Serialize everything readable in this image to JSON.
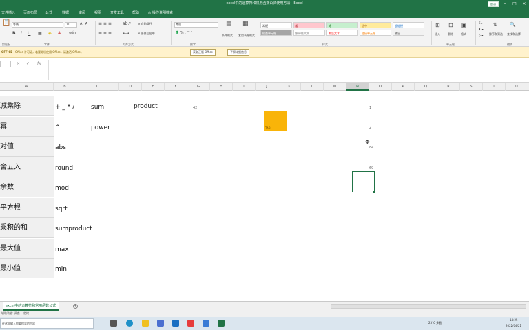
{
  "window": {
    "title": "excel中的运算符和常用函数公式使用方法  -  Excel",
    "signin": "登录"
  },
  "ribbon_tabs": [
    "文件",
    "插入",
    "页面布局",
    "公式",
    "数据",
    "审阅",
    "视图",
    "开发工具",
    "帮助",
    "操作说明搜索"
  ],
  "active_tab": "开始",
  "ribbon": {
    "font_name": "等线",
    "font_size": "11",
    "number_format": "常规",
    "groups": [
      "剪贴板",
      "字体",
      "对齐方式",
      "数字",
      "样式",
      "单元格",
      "编辑"
    ],
    "styles": [
      {
        "label": "常规",
        "bg": "#ffffff",
        "color": "#000000"
      },
      {
        "label": "差",
        "bg": "#ffc7ce",
        "color": "#9c0006"
      },
      {
        "label": "好",
        "bg": "#c6efce",
        "color": "#006100"
      },
      {
        "label": "适中",
        "bg": "#ffeb9c",
        "color": "#9c5700"
      },
      {
        "label": "超链接",
        "bg": "#ffffff",
        "color": "#0563c1"
      },
      {
        "label": "检查单元格",
        "bg": "#a5a5a5",
        "color": "#ffffff"
      },
      {
        "label": "解释性文本",
        "bg": "#ffffff",
        "color": "#7f7f7f"
      },
      {
        "label": "警告文本",
        "bg": "#ffffff",
        "color": "#ff0000"
      },
      {
        "label": "链接单元格",
        "bg": "#ffffff",
        "color": "#fa7d00"
      },
      {
        "label": "输出",
        "bg": "#f2f2f2",
        "color": "#3f3f3f"
      }
    ],
    "buttons": {
      "conditional": "条件格式",
      "table": "套用表格格式",
      "insert": "插入",
      "delete": "删除",
      "format": "格式",
      "sort": "排序和筛选",
      "find": "查找和选择",
      "wrap": "自动换行",
      "merge": "合并后居中"
    }
  },
  "message_bar": {
    "label": "OFFICE",
    "text": "Office 许可证，若要继续使用 Office，请激活 Office。",
    "button1": "获取正版 Office",
    "button2": "了解详细信息"
  },
  "formula_bar": {
    "cancel": "×",
    "confirm": "✓",
    "fx": "fx"
  },
  "columns": [
    "A",
    "B",
    "C",
    "D",
    "E",
    "F",
    "G",
    "H",
    "I",
    "J",
    "K",
    "L",
    "M",
    "N",
    "O",
    "P",
    "Q",
    "R",
    "S",
    "T",
    "U"
  ],
  "selected_column": "N",
  "sheet": {
    "labels": [
      "减乘除",
      "幂",
      "对值",
      "舍五入",
      "余数",
      "平方根",
      "乘积的和",
      "最大值",
      "最小值"
    ],
    "col_b": [
      "+ _ * /",
      "^",
      "abs",
      "round",
      "mod",
      "sqrt",
      "sumproduct",
      "max",
      "min"
    ],
    "col_c": [
      "sum",
      "power"
    ],
    "col_e": "product",
    "f1": "42",
    "yellow_label": "TAB",
    "n_values": [
      "1",
      "2",
      "84",
      "69"
    ]
  },
  "sheet_tab": "excel中的运算符和常用函数公式",
  "status": {
    "left": "辅助功能: 调查",
    "mode": "就绪"
  },
  "taskbar": {
    "search": "在这里输入你要搜索的内容",
    "weather": "23°C 多云",
    "time": "14:25",
    "date": "2022/04/21"
  }
}
